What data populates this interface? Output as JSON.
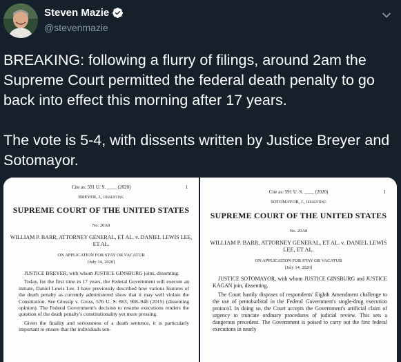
{
  "author": {
    "display_name": "Steven Mazie",
    "handle": "@stevenmazie",
    "verified": true
  },
  "tweet": {
    "paragraph1": "BREAKING: following a flurry of filings, around 2am the Supreme Court permitted the federal death penalty to go back into effect this morning after 17 years.",
    "paragraph2": "The vote is 5-4, with dissents written by Justice Breyer and Sotomayor."
  },
  "icons": {
    "verified": "verified-badge-icon",
    "more": "chevron-down-icon"
  },
  "colors": {
    "background": "#15202b",
    "secondary_text": "#8899a6",
    "verified_blue": "#1da1f2"
  },
  "media": {
    "left_doc": {
      "cite": "Cite as: 591 U. S. ____ (2020)",
      "page": "1",
      "justice": "BREYER, J., dissenting",
      "court": "SUPREME COURT OF THE UNITED STATES",
      "no": "No. 20A8",
      "parties": "WILLIAM P. BARR, ATTORNEY GENERAL, ET AL. v. DANIEL LEWIS LEE, ET AL.",
      "application": "ON APPLICATION FOR STAY OR VACATUR",
      "date": "[July 14, 2020]",
      "para1": "JUSTICE BREYER, with whom JUSTICE GINSBURG joins, dissenting.",
      "para2": "Today, for the first time in 17 years, the Federal Government will execute an inmate, Daniel Lewis Lee. I have previously described how various features of the death penalty as currently administered show that it may well violate the Constitution. See Glossip v. Gross, 576 U. S. 863, 908–946 (2015) (dissenting opinion). The Federal Government's decision to resume executions renders the question of the death penalty's constitutionality yet more pressing.",
      "para3": "Given the finality and seriousness of a death sentence, it is particularly important to ensure that the individuals sen-"
    },
    "right_doc": {
      "cite": "Cite as: 591 U. S. ____ (2020)",
      "page": "1",
      "justice": "SOTOMAYOR, J., dissenting",
      "court": "SUPREME COURT OF THE UNITED STATES",
      "no": "No. 20A8",
      "parties": "WILLIAM P. BARR, ATTORNEY GENERAL, ET AL. v. DANIEL LEWIS LEE, ET AL.",
      "application": "ON APPLICATION FOR STAY OR VACATUR",
      "date": "[July 14, 2020]",
      "para1": "JUSTICE SOTOMAYOR, with whom JUSTICE GINSBURG and JUSTICE KAGAN join, dissenting.",
      "para2": "The Court hastily disposes of respondents' Eighth Amendment challenge to the use of pentobarbital in the Federal Government's single-drug execution protocol. In doing so, the Court accepts the Government's artificial claim of urgency to truncate ordinary procedures of judicial review. This sets a dangerous precedent. The Government is poised to carry out the first federal executions in nearly"
    }
  }
}
